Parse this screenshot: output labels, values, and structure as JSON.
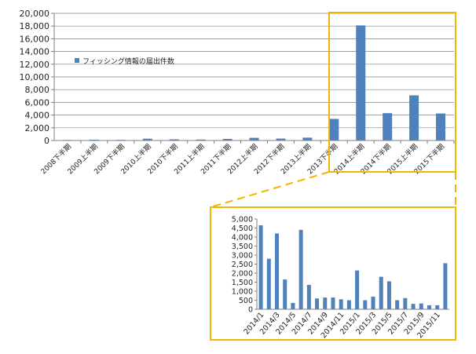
{
  "colors": {
    "bar": "#4f81bd",
    "highlight": "#f2b600",
    "axis": "#808080",
    "grid": "#808080"
  },
  "chart_data": [
    {
      "type": "bar",
      "title": "",
      "xlabel": "",
      "ylabel": "",
      "legend": {
        "label": "フィッシング情報の届出件数",
        "placement": "top-left"
      },
      "ylim": [
        0,
        20000
      ],
      "yticks": [
        "0",
        "2,000",
        "4,000",
        "6,000",
        "8,000",
        "10,000",
        "12,000",
        "14,000",
        "16,000",
        "18,000",
        "20,000"
      ],
      "grid": true,
      "categories": [
        "2008下半期",
        "2009上半期",
        "2009下半期",
        "2010上半期",
        "2010下半期",
        "2011上半期",
        "2011下半期",
        "2012上半期",
        "2012下半期",
        "2013上半期",
        "2013下半期",
        "2014上半期",
        "2014下半期",
        "2015上半期",
        "2015下半期"
      ],
      "values": [
        80,
        120,
        100,
        280,
        180,
        150,
        250,
        420,
        300,
        450,
        3400,
        18100,
        4300,
        7100,
        4250
      ]
    },
    {
      "type": "bar",
      "title": "",
      "xlabel": "",
      "ylabel": "",
      "ylim": [
        0,
        5000
      ],
      "yticks": [
        "0",
        "500",
        "1,000",
        "1,500",
        "2,000",
        "2,500",
        "3,000",
        "3,500",
        "4,000",
        "4,500",
        "5,000"
      ],
      "grid": false,
      "categories": [
        "2014/1",
        "2014/2",
        "2014/3",
        "2014/4",
        "2014/5",
        "2014/6",
        "2014/7",
        "2014/8",
        "2014/9",
        "2014/10",
        "2014/11",
        "2014/12",
        "2015/1",
        "2015/2",
        "2015/3",
        "2015/4",
        "2015/5",
        "2015/6",
        "2015/7",
        "2015/8",
        "2015/9",
        "2015/10",
        "2015/11",
        "2015/12"
      ],
      "tick_labels": [
        "2014/1",
        "2014/3",
        "2014/5",
        "2014/7",
        "2014/9",
        "2014/11",
        "2015/1",
        "2015/3",
        "2015/5",
        "2015/7",
        "2015/9",
        "2015/11"
      ],
      "values": [
        4650,
        2800,
        4200,
        1650,
        350,
        4400,
        1350,
        600,
        650,
        650,
        550,
        500,
        2150,
        500,
        700,
        1800,
        1550,
        500,
        620,
        300,
        320,
        220,
        220,
        2550
      ]
    }
  ]
}
